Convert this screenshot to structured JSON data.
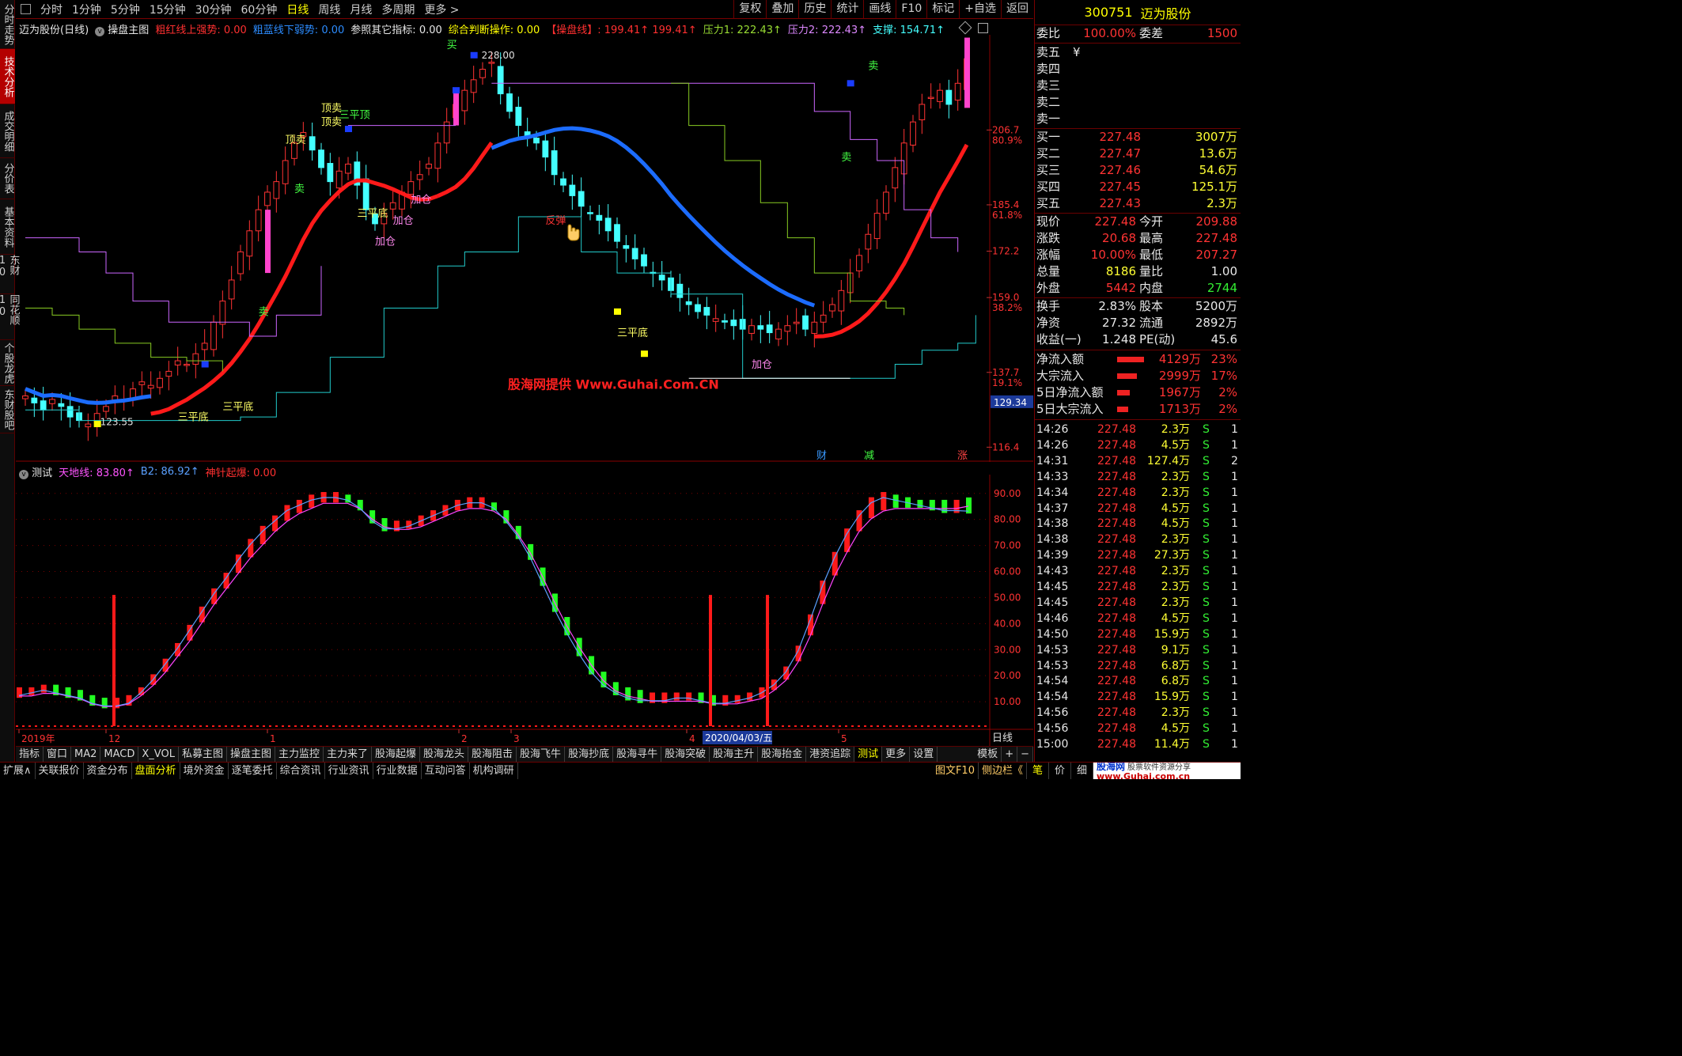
{
  "nav": {
    "left_tabs": [
      "分时走势",
      "技术分析",
      "成交明细",
      "分价表",
      "基本资料",
      "东财10",
      "同花顺10",
      "个股龙虎",
      "东财股吧"
    ],
    "periods": [
      "分时",
      "1分钟",
      "5分钟",
      "15分钟",
      "30分钟",
      "60分钟",
      "日线",
      "周线",
      "月线",
      "多周期",
      "更多 >"
    ],
    "tools": [
      "复权",
      "叠加",
      "历史",
      "统计",
      "画线",
      "F10",
      "标记",
      "+自选",
      "返回"
    ]
  },
  "main_header": {
    "stock": "迈为股份(日线)",
    "template": "操盘主图",
    "red_label": "粗红线上强势:",
    "red_val": "0.00",
    "blue_label": "粗蓝线下弱势:",
    "blue_val": "0.00",
    "ref_label": "参照其它指标:",
    "ref_val": "0.00",
    "op_label": "综合判断操作:",
    "op_val": "0.00",
    "line_label": "【操盘线】:",
    "line_val1": "199.41↑",
    "line_val2": "199.41↑",
    "p1_label": "压力1:",
    "p1_val": "222.43↑",
    "p2_label": "压力2:",
    "p2_val": "222.43↑",
    "sup_label": "支撑:",
    "sup_val": "154.71↑"
  },
  "price_axis": [
    {
      "v": "206.7",
      "pct": "80.9%"
    },
    {
      "v": "185.4",
      "pct": "61.8%"
    },
    {
      "v": "172.2",
      "pct": ""
    },
    {
      "v": "159.0",
      "pct": "38.2%"
    },
    {
      "v": "137.7",
      "pct": "19.1%"
    },
    {
      "v": "116.4",
      "pct": ""
    }
  ],
  "axis_highlight": "129.34",
  "price_marks": {
    "high": "228.00",
    "low": "123.55"
  },
  "annotations": {
    "top_sell": "顶卖",
    "three_top": "三平顶",
    "three_bottom": "三平底",
    "add": "加仓",
    "sell": "卖",
    "rebound": "反弹",
    "buy": "买"
  },
  "watermark": "股海网提供 Www.Guhai.Com.CN",
  "badges": [
    "财",
    "减",
    "涨"
  ],
  "sub_header": {
    "name": "测试",
    "l1": "天地线:",
    "v1": "83.80↑",
    "l2": "B2:",
    "v2": "86.92↑",
    "l3": "神针起爆:",
    "v3": "0.00"
  },
  "sub_axis": [
    "90.00",
    "80.00",
    "70.00",
    "60.00",
    "50.00",
    "40.00",
    "30.00",
    "20.00",
    "10.00"
  ],
  "date_axis": {
    "labels": [
      "2019年",
      "12",
      "1",
      "2",
      "3",
      "4",
      "5"
    ],
    "cursor": "2020/04/03/五",
    "period": "日线"
  },
  "bottom_tabs": [
    "指标",
    "窗口",
    "MA2",
    "MACD",
    "X_VOL",
    "私募主图",
    "操盘主图",
    "主力监控",
    "主力来了",
    "股海起爆",
    "股海龙头",
    "股海阻击",
    "股海飞牛",
    "股海抄底",
    "股海寻牛",
    "股海突破",
    "股海主升",
    "股海抬金",
    "港资追踪",
    "测试",
    "更多",
    "设置",
    "模板",
    "+",
    "−"
  ],
  "status_tabs": [
    "扩展∧",
    "关联报价",
    "资金分布",
    "盘面分析",
    "境外资金",
    "逐笔委托",
    "综合资讯",
    "行业资讯",
    "行业数据",
    "互动问答",
    "机构调研"
  ],
  "status_right": [
    "图文F10",
    "侧边栏《"
  ],
  "right_tabs": [
    "笔",
    "价",
    "细"
  ],
  "logo_text": "股海网",
  "logo_sub": "股票软件资源分享",
  "logo_url": "www.Guhai.com.cn",
  "quote": {
    "code": "300751",
    "name": "迈为股份",
    "wb_label": "委比",
    "wb": "100.00%",
    "wc_label": "委差",
    "wc": "1500",
    "sell": [
      {
        "l": "卖五",
        "p": "¥",
        "v": ""
      },
      {
        "l": "卖四",
        "p": "",
        "v": ""
      },
      {
        "l": "卖三",
        "p": "",
        "v": ""
      },
      {
        "l": "卖二",
        "p": "",
        "v": ""
      },
      {
        "l": "卖一",
        "p": "",
        "v": ""
      }
    ],
    "buy": [
      {
        "l": "买一",
        "p": "227.48",
        "v": "3007万"
      },
      {
        "l": "买二",
        "p": "227.47",
        "v": "13.6万"
      },
      {
        "l": "买三",
        "p": "227.46",
        "v": "54.6万"
      },
      {
        "l": "买四",
        "p": "227.45",
        "v": "125.1万"
      },
      {
        "l": "买五",
        "p": "227.43",
        "v": "2.3万"
      }
    ],
    "stats": [
      {
        "l1": "现价",
        "v1": "227.48",
        "l2": "今开",
        "v2": "209.88",
        "c1": "red",
        "c2": "red"
      },
      {
        "l1": "涨跌",
        "v1": "20.68",
        "l2": "最高",
        "v2": "227.48",
        "c1": "red",
        "c2": "red"
      },
      {
        "l1": "涨幅",
        "v1": "10.00%",
        "l2": "最低",
        "v2": "207.27",
        "c1": "red",
        "c2": "red"
      },
      {
        "l1": "总量",
        "v1": "8186",
        "l2": "量比",
        "v2": "1.00",
        "c1": "yel",
        "c2": "wht"
      },
      {
        "l1": "外盘",
        "v1": "5442",
        "l2": "内盘",
        "v2": "2744",
        "c1": "red",
        "c2": "grn"
      }
    ],
    "stats2": [
      {
        "l1": "换手",
        "v1": "2.83%",
        "l2": "股本",
        "v2": "5200万"
      },
      {
        "l1": "净资",
        "v1": "27.32",
        "l2": "流通",
        "v2": "2892万"
      },
      {
        "l1": "收益(一)",
        "v1": "1.248",
        "l2": "PE(动)",
        "v2": "45.6"
      }
    ],
    "flows": [
      {
        "l": "净流入额",
        "v": "4129万",
        "p": "23%",
        "bar": 0.9
      },
      {
        "l": "大宗流入",
        "v": "2999万",
        "p": "17%",
        "bar": 0.65
      },
      {
        "l": "5日净流入额",
        "v": "1967万",
        "p": "2%",
        "bar": 0.42
      },
      {
        "l": "5日大宗流入",
        "v": "1713万",
        "p": "2%",
        "bar": 0.37
      }
    ],
    "ticks": [
      {
        "t": "14:26",
        "p": "227.48",
        "v": "2.3万",
        "s": "S",
        "n": "1"
      },
      {
        "t": "14:26",
        "p": "227.48",
        "v": "4.5万",
        "s": "S",
        "n": "1"
      },
      {
        "t": "14:31",
        "p": "227.48",
        "v": "127.4万",
        "s": "S",
        "n": "2"
      },
      {
        "t": "14:33",
        "p": "227.48",
        "v": "2.3万",
        "s": "S",
        "n": "1"
      },
      {
        "t": "14:34",
        "p": "227.48",
        "v": "2.3万",
        "s": "S",
        "n": "1"
      },
      {
        "t": "14:37",
        "p": "227.48",
        "v": "4.5万",
        "s": "S",
        "n": "1"
      },
      {
        "t": "14:38",
        "p": "227.48",
        "v": "4.5万",
        "s": "S",
        "n": "1"
      },
      {
        "t": "14:38",
        "p": "227.48",
        "v": "2.3万",
        "s": "S",
        "n": "1"
      },
      {
        "t": "14:39",
        "p": "227.48",
        "v": "27.3万",
        "s": "S",
        "n": "1"
      },
      {
        "t": "14:43",
        "p": "227.48",
        "v": "2.3万",
        "s": "S",
        "n": "1"
      },
      {
        "t": "14:45",
        "p": "227.48",
        "v": "2.3万",
        "s": "S",
        "n": "1"
      },
      {
        "t": "14:45",
        "p": "227.48",
        "v": "2.3万",
        "s": "S",
        "n": "1"
      },
      {
        "t": "14:46",
        "p": "227.48",
        "v": "4.5万",
        "s": "S",
        "n": "1"
      },
      {
        "t": "14:50",
        "p": "227.48",
        "v": "15.9万",
        "s": "S",
        "n": "1"
      },
      {
        "t": "14:53",
        "p": "227.48",
        "v": "9.1万",
        "s": "S",
        "n": "1"
      },
      {
        "t": "14:53",
        "p": "227.48",
        "v": "6.8万",
        "s": "S",
        "n": "1"
      },
      {
        "t": "14:54",
        "p": "227.48",
        "v": "6.8万",
        "s": "S",
        "n": "1"
      },
      {
        "t": "14:54",
        "p": "227.48",
        "v": "15.9万",
        "s": "S",
        "n": "1"
      },
      {
        "t": "14:56",
        "p": "227.48",
        "v": "2.3万",
        "s": "S",
        "n": "1"
      },
      {
        "t": "14:56",
        "p": "227.48",
        "v": "4.5万",
        "s": "S",
        "n": "1"
      },
      {
        "t": "15:00",
        "p": "227.48",
        "v": "11.4万",
        "s": "S",
        "n": "1"
      }
    ]
  },
  "chart_data": {
    "type": "candlestick",
    "candles_close": [
      131,
      129,
      127,
      130,
      128,
      125,
      124,
      123,
      126,
      128,
      131,
      130,
      133,
      135,
      134,
      136,
      138,
      141,
      140,
      143,
      146,
      152,
      158,
      164,
      172,
      178,
      184,
      189,
      192,
      198,
      203,
      206,
      201,
      196,
      192,
      195,
      197,
      191,
      184,
      180,
      183,
      186,
      189,
      192,
      194,
      197,
      203,
      209,
      214,
      218,
      221,
      224,
      226,
      217,
      212,
      208,
      205,
      203,
      199,
      194,
      191,
      188,
      185,
      183,
      181,
      178,
      175,
      173,
      170,
      168,
      166,
      164,
      161,
      159,
      157,
      155,
      154,
      153,
      152,
      151,
      150,
      151,
      150,
      149,
      150,
      151,
      152,
      150,
      152,
      154,
      157,
      161,
      166,
      171,
      177,
      183,
      189,
      196,
      203,
      209,
      214,
      216,
      218,
      214,
      220,
      227
    ],
    "red_ma_note": "粗红线",
    "blue_ma_note": "粗蓝线",
    "indicator": {
      "name": "测试",
      "series": [
        {
          "name": "天地线",
          "values": [
            13,
            14,
            15,
            14,
            13,
            12,
            10,
            9,
            9,
            10,
            14,
            19,
            25,
            31,
            38,
            45,
            52,
            58,
            65,
            71,
            76,
            80,
            84,
            86,
            88,
            89,
            89,
            88,
            85,
            80,
            77,
            77,
            78,
            80,
            82,
            84,
            86,
            87,
            87,
            85,
            80,
            74,
            66,
            56,
            46,
            37,
            29,
            22,
            17,
            14,
            12,
            11,
            11,
            11,
            12,
            12,
            11,
            10,
            10,
            11,
            12,
            14,
            17,
            22,
            30,
            42,
            55,
            66,
            75,
            82,
            87,
            89,
            88,
            87,
            86,
            85,
            84,
            84,
            83.8
          ]
        },
        {
          "name": "B2",
          "values": [
            14,
            14,
            15,
            15,
            14,
            13,
            11,
            10,
            10,
            11,
            14,
            18,
            23,
            29,
            35,
            42,
            49,
            55,
            61,
            67,
            72,
            77,
            81,
            84,
            86,
            88,
            88,
            88,
            86,
            82,
            79,
            78,
            78,
            79,
            81,
            83,
            85,
            86,
            86,
            85,
            82,
            76,
            69,
            60,
            50,
            41,
            33,
            26,
            20,
            16,
            14,
            13,
            12,
            12,
            12,
            12,
            12,
            11,
            11,
            11,
            12,
            13,
            16,
            20,
            27,
            37,
            49,
            60,
            69,
            77,
            82,
            85,
            86,
            86,
            86,
            86,
            86,
            86,
            86.92
          ]
        }
      ],
      "spikes_at": [
        "12月",
        "2020/04/03",
        "4月"
      ]
    }
  }
}
